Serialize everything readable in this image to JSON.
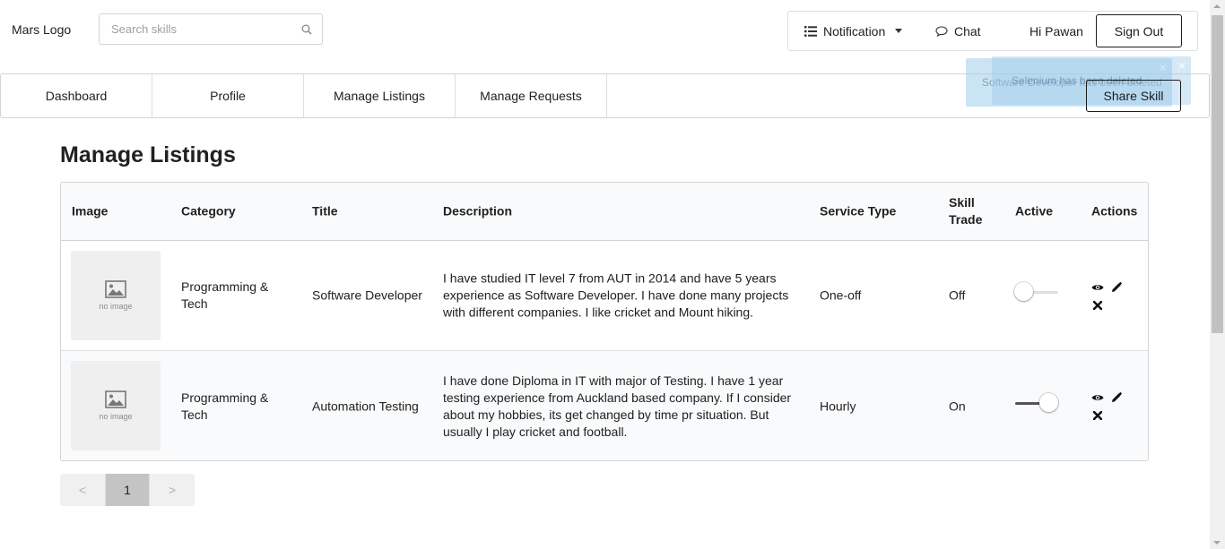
{
  "header": {
    "logo": "Mars Logo",
    "search_placeholder": "Search skills",
    "notification_label": "Notification",
    "chat_label": "Chat",
    "greeting": "Hi Pawan",
    "signout_label": "Sign Out"
  },
  "nav": {
    "items": [
      "Dashboard",
      "Profile",
      "Manage Listings",
      "Manage Requests"
    ],
    "share_label": "Share Skill"
  },
  "toasts": [
    "Software Developer has been deleted",
    "Selenium has been deleted"
  ],
  "page_title": "Manage Listings",
  "table": {
    "columns": [
      "Image",
      "Category",
      "Title",
      "Description",
      "Service Type",
      "Skill Trade",
      "Active",
      "Actions"
    ],
    "no_image_text": "no image",
    "rows": [
      {
        "category": "Programming & Tech",
        "title": "Software Developer",
        "description": "I have studied IT level 7 from AUT in 2014 and have 5 years experience as Software Developer. I have done many projects with different companies. I like cricket and Mount hiking.",
        "service_type": "One-off",
        "skill_trade": "Off",
        "active": false
      },
      {
        "category": "Programming & Tech",
        "title": "Automation Testing",
        "description": "I have done Diploma in IT with major of Testing. I have 1 year testing experience from Auckland based company. If I consider about my hobbies, its get changed by time pr situation. But usually I play cricket and football.",
        "service_type": "Hourly",
        "skill_trade": "On",
        "active": true
      }
    ]
  },
  "pagination": {
    "prev": "<",
    "current": "1",
    "next": ">"
  },
  "colors": {
    "toast_bg": "#a0cdeb",
    "toggle_on": "#545454",
    "toggle_off": "#e0e0e0"
  }
}
